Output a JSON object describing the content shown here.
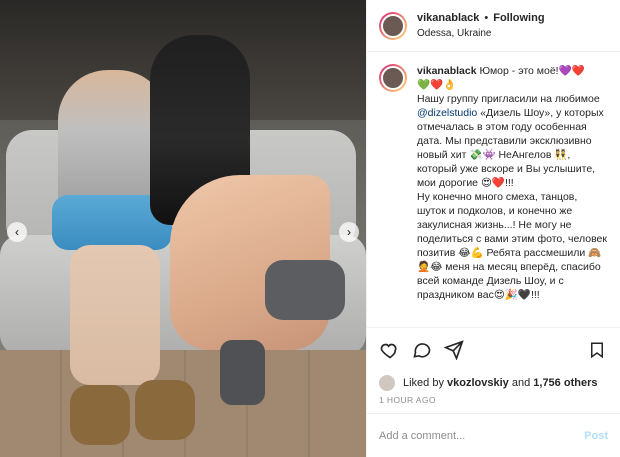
{
  "colors": {
    "link": "#00376b",
    "post_button": "#b2dffc",
    "muted": "#8e8e8e"
  },
  "media": {
    "left_arrow_icon": "chevron-left-icon",
    "right_arrow_icon": "chevron-right-icon"
  },
  "header": {
    "username": "vikanablack",
    "separator": "•",
    "follow_label": "Following",
    "location": "Odessa, Ukraine"
  },
  "caption": {
    "username": "vikanablack",
    "text_1": "Юмор - это моё!💜❤️",
    "text_2": "💚❤️👌",
    "text_3": "Нашу группу пригласили на любимое ",
    "mention": "@dizelstudio",
    "text_4": " «Дизель Шоу», у которых отмечалась в этом году особенная дата. Мы представили эксклюзивно новый хит 💸👾 НеАнгелов 👯, который уже вскоре и Вы услышите, мои дорогие 😍❤️!!!",
    "text_5": "Ну конечно много смеха, танцов, шуток и подколов, и конечно же закулисная жизнь...! Не могу не поделиться с вами этим фото, человек позитив 😂💪 Ребята рассмешили 🙈🤦😂 меня на месяц вперёд, спасибо всей команде Дизель Шоу, и с праздником вас😍🎉🖤!!!"
  },
  "actions": {
    "like_icon": "heart-icon",
    "comment_icon": "comment-icon",
    "share_icon": "send-icon",
    "save_icon": "bookmark-icon"
  },
  "likes": {
    "prefix": "Liked by ",
    "user": "vkozlovskiy",
    "middle": " and ",
    "count": "1,756 others"
  },
  "time_label": "1 HOUR AGO",
  "comment_box": {
    "placeholder": "Add a comment...",
    "post_label": "Post"
  }
}
